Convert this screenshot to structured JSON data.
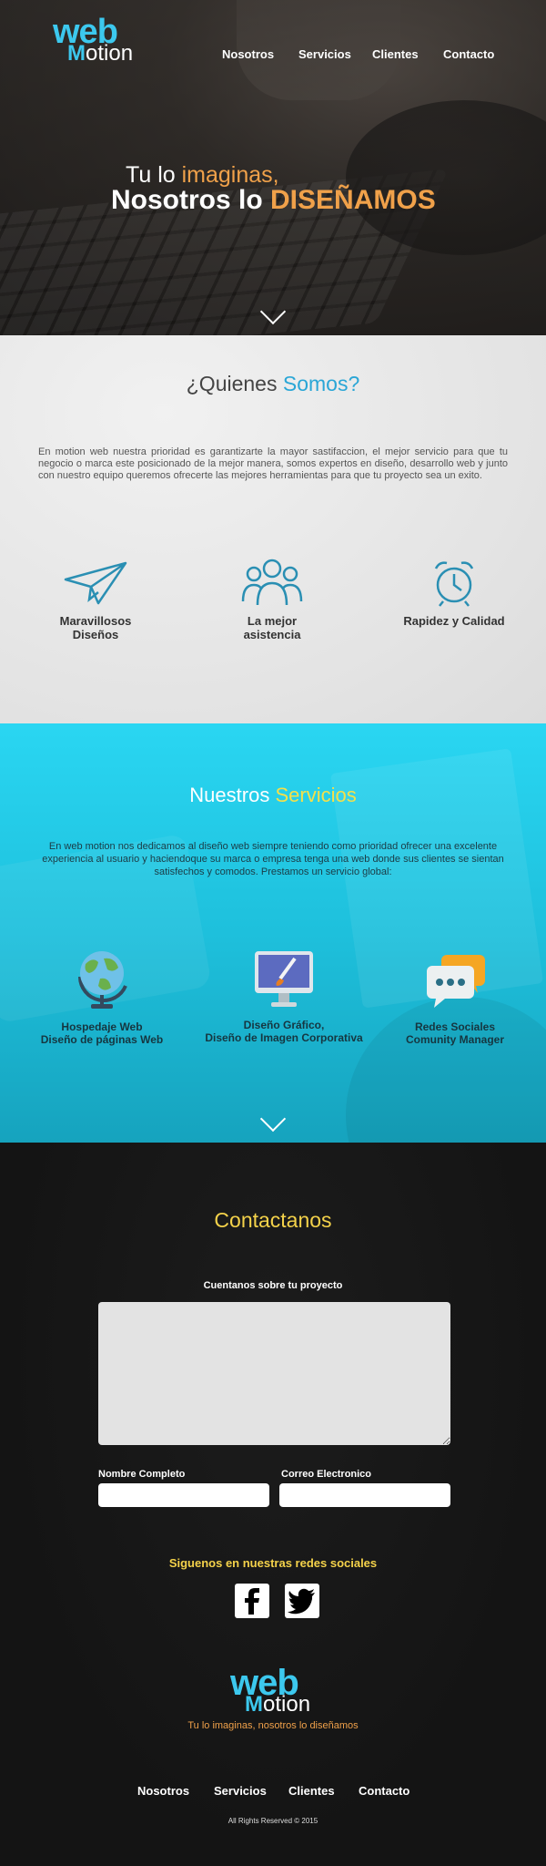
{
  "header": {
    "logo_top": "web",
    "logo_bottom_first": "M",
    "logo_bottom_rest": "otion",
    "nav": [
      "Nosotros",
      "Servicios",
      "Clientes",
      "Contacto"
    ]
  },
  "hero": {
    "line1_a": "Tu lo ",
    "line1_b": "imaginas,",
    "line2_a": "Nosotros lo ",
    "line2_b": "DISEÑAMOS"
  },
  "quienes": {
    "title_a": "¿Quienes ",
    "title_b": "Somos?",
    "text": "En motion web nuestra prioridad es garantizarte la mayor sastifaccion, el mejor servicio para que tu negocio o marca este posicionado de la mejor manera, somos expertos en diseño, desarrollo web y junto con nuestro equipo queremos ofrecerte las mejores herramientas para que tu proyecto sea un exito.",
    "features": [
      {
        "icon": "paper-plane-icon",
        "label_l1": "Maravillosos",
        "label_l2": "Diseños"
      },
      {
        "icon": "team-icon",
        "label_l1": "La mejor",
        "label_l2": "asistencia"
      },
      {
        "icon": "alarm-clock-icon",
        "label_l1": "Rapidez y Calidad",
        "label_l2": ""
      }
    ]
  },
  "servicios": {
    "title_a": "Nuestros ",
    "title_b": "Servicios",
    "text": "En web motion nos dedicamos al diseño web siempre teniendo como prioridad ofrecer una excelente experiencia al usuario y haciendoque su marca o empresa tenga una web donde sus clientes se sientan satisfechos y comodos. Prestamos un servicio global:",
    "items": [
      {
        "icon": "globe-icon",
        "l1": "Hospedaje Web",
        "l2": "Diseño de páginas Web"
      },
      {
        "icon": "monitor-brush-icon",
        "l1": "Diseño Gráfico,",
        "l2": "Diseño de Imagen Corporativa"
      },
      {
        "icon": "chat-bubbles-icon",
        "l1": "Redes Sociales",
        "l2": "Comunity Manager"
      }
    ]
  },
  "contact": {
    "title": "Contactanos",
    "project_label": "Cuentanos sobre tu proyecto",
    "name_label": "Nombre Completo",
    "email_label": "Correo Electronico",
    "social_label": "Siguenos en nuestras redes sociales",
    "tagline": "Tu lo imaginas, nosotros lo diseñamos",
    "footer_nav": [
      "Nosotros",
      "Servicios",
      "Clientes",
      "Contacto"
    ],
    "copyright": "All Rights Reserved © 2015"
  },
  "colors": {
    "accent_blue": "#2aa6d6",
    "accent_orange": "#f0a14a",
    "accent_yellow": "#f4d24a"
  }
}
